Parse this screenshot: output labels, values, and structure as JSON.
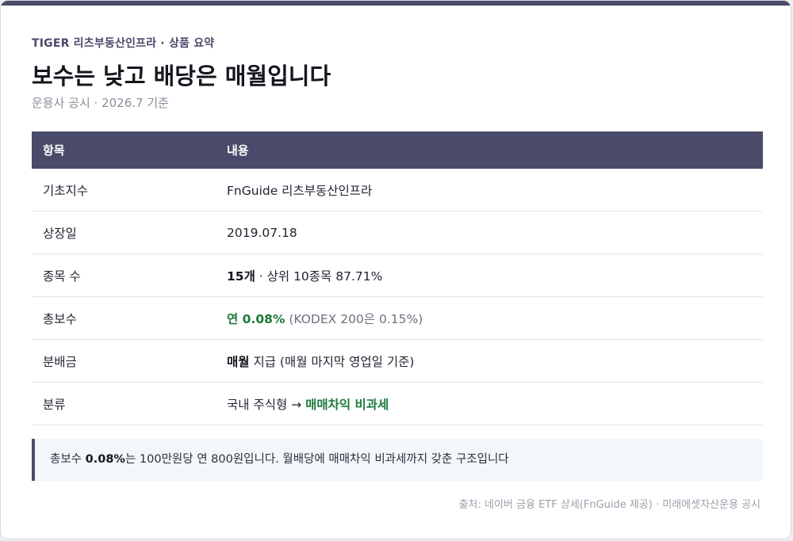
{
  "header": {
    "eyebrow": "TIGER 리츠부동산인프라 · 상품 요약",
    "title": "보수는 낮고 배당은 매월입니다",
    "subtitle": "운용사 공시 · 2026.7 기준"
  },
  "table": {
    "columns": [
      "항목",
      "내용"
    ],
    "rows": [
      {
        "key": "기초지수",
        "value": "FnGuide 리츠부동산인프라"
      },
      {
        "key": "상장일",
        "value": "2019.07.18"
      },
      {
        "key": "종목 수",
        "value_strong": "15개",
        "value_rest": " · 상위 10종목 87.71%"
      },
      {
        "key": "총보수",
        "value_highlight": "연 0.08%",
        "value_rest": " (KODEX 200은 0.15%)"
      },
      {
        "key": "분배금",
        "value_strong": "매월",
        "value_rest": " 지급 (매월 마지막 영업일 기준)"
      },
      {
        "key": "분류",
        "value_plain": "국내 주식형 → ",
        "value_highlight": "매매차익 비과세"
      }
    ]
  },
  "callout": {
    "prefix": "총보수 ",
    "strong": "0.08%",
    "text": "는 100만원당 연 800원입니다. 월배당에 매매차익 비과세까지 갖춘 구조입니다"
  },
  "source": "출처: 네이버 금융 ETF 상세(FnGuide 제공) · 미래에셋자산운용 공시",
  "colors": {
    "accent": "#4a4a6a",
    "highlight_green": "#1e7a3a",
    "muted": "#8a8f9c"
  }
}
